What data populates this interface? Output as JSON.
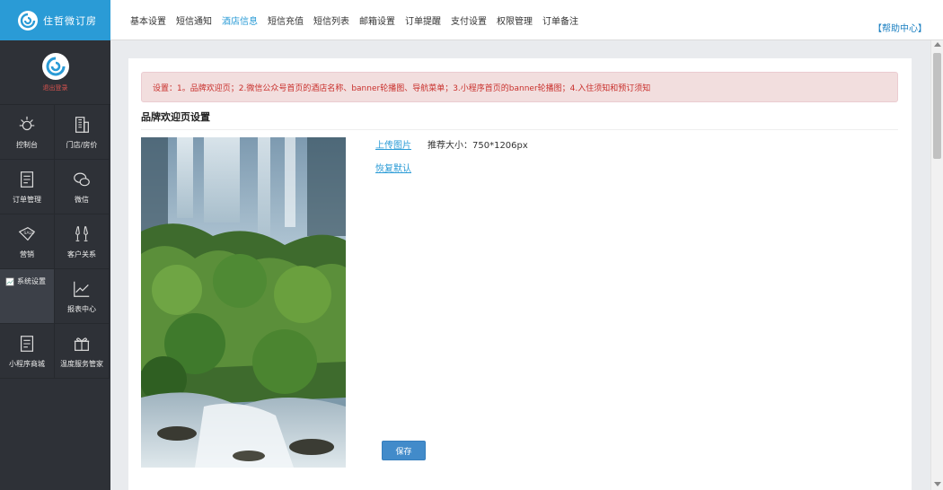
{
  "brand": {
    "name": "住哲微订房"
  },
  "profile": {
    "logout": "退出登录"
  },
  "sidebar": {
    "items": [
      {
        "label": "控制台",
        "icon": "dashboard-icon"
      },
      {
        "label": "门店/房价",
        "icon": "building-icon"
      },
      {
        "label": "订单管理",
        "icon": "document-icon"
      },
      {
        "label": "微信",
        "icon": "wechat-icon"
      },
      {
        "label": "营销",
        "icon": "sale-tag-icon"
      },
      {
        "label": "客户关系",
        "icon": "glasses-icon"
      },
      {
        "label": "系统设置",
        "icon": "broken-image-icon"
      },
      {
        "label": "报表中心",
        "icon": "chart-icon"
      },
      {
        "label": "小程序商城",
        "icon": "document-icon"
      },
      {
        "label": "温度服务管家",
        "icon": "gift-icon"
      }
    ]
  },
  "tabs": [
    "基本设置",
    "短信通知",
    "酒店信息",
    "短信充值",
    "短信列表",
    "邮箱设置",
    "订单提醒",
    "支付设置",
    "权限管理",
    "订单备注"
  ],
  "active_tab": "酒店信息",
  "help": "【帮助中心】",
  "notice": "设置：1。品牌欢迎页；2.微信公众号首页的酒店名称、banner轮播图、导航菜单；3.小程序首页的banner轮播图；4.入住须知和预订须知",
  "section": {
    "title": "品牌欢迎页设置"
  },
  "upload": {
    "link": "上传图片",
    "hint": "推荐大小：750*1206px",
    "reset": "恢复默认"
  },
  "save_label": "保存",
  "colors": {
    "primary": "#2a9bd6",
    "sidebar": "#2e3137",
    "alert_bg": "#f2dede",
    "alert_text": "#c9302c"
  }
}
